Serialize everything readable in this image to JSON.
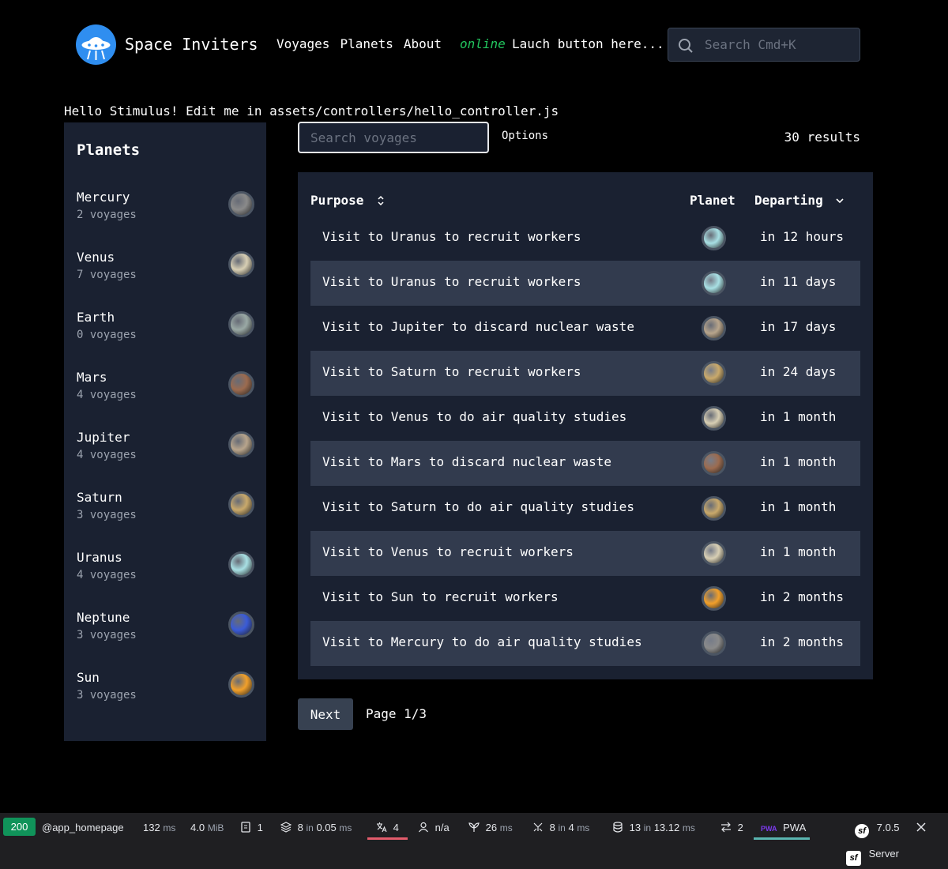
{
  "header": {
    "brand": "Space Inviters",
    "nav": [
      "Voyages",
      "Planets",
      "About"
    ],
    "online_status": "online",
    "launch_text": "Lauch button here...",
    "search_placeholder": "Search Cmd+K"
  },
  "hello_text": "Hello Stimulus! Edit me in assets/controllers/hello_controller.js",
  "sidebar": {
    "title": "Planets",
    "planets": [
      {
        "name": "Mercury",
        "count": "2 voyages",
        "color": "#8a8a8a"
      },
      {
        "name": "Venus",
        "count": "7 voyages",
        "color": "#d8cfb4"
      },
      {
        "name": "Earth",
        "count": "0 voyages",
        "color": "#9aa9a5"
      },
      {
        "name": "Mars",
        "count": "4 voyages",
        "color": "#9c6b4f"
      },
      {
        "name": "Jupiter",
        "count": "4 voyages",
        "color": "#b8a58c"
      },
      {
        "name": "Saturn",
        "count": "3 voyages",
        "color": "#c9a96b"
      },
      {
        "name": "Uranus",
        "count": "4 voyages",
        "color": "#a8e0e4"
      },
      {
        "name": "Neptune",
        "count": "3 voyages",
        "color": "#3a5bd8"
      },
      {
        "name": "Sun",
        "count": "3 voyages",
        "color": "#f2a02a"
      }
    ]
  },
  "voyages": {
    "search_placeholder": "Search voyages",
    "options_label": "Options",
    "results": "30 results",
    "columns": {
      "purpose": "Purpose",
      "planet": "Planet",
      "departing": "Departing"
    },
    "rows": [
      {
        "purpose": "Visit to Uranus to recruit workers",
        "planet": "Uranus",
        "color": "#a8e0e4",
        "departing": "in 12 hours"
      },
      {
        "purpose": "Visit to Uranus to recruit workers",
        "planet": "Uranus",
        "color": "#a8e0e4",
        "departing": "in 11 days"
      },
      {
        "purpose": "Visit to Jupiter to discard nuclear waste",
        "planet": "Jupiter",
        "color": "#b8a58c",
        "departing": "in 17 days"
      },
      {
        "purpose": "Visit to Saturn to recruit workers",
        "planet": "Saturn",
        "color": "#c9a96b",
        "departing": "in 24 days"
      },
      {
        "purpose": "Visit to Venus to do air quality studies",
        "planet": "Venus",
        "color": "#d8cfb4",
        "departing": "in 1 month"
      },
      {
        "purpose": "Visit to Mars to discard nuclear waste",
        "planet": "Mars",
        "color": "#9c6b4f",
        "departing": "in 1 month"
      },
      {
        "purpose": "Visit to Saturn to do air quality studies",
        "planet": "Saturn",
        "color": "#c9a96b",
        "departing": "in 1 month"
      },
      {
        "purpose": "Visit to Venus to recruit workers",
        "planet": "Venus",
        "color": "#d8cfb4",
        "departing": "in 1 month"
      },
      {
        "purpose": "Visit to Sun to recruit workers",
        "planet": "Sun",
        "color": "#f2a02a",
        "departing": "in 2 months"
      },
      {
        "purpose": "Visit to Mercury to do air quality studies",
        "planet": "Mercury",
        "color": "#8a8a8a",
        "departing": "in 2 months"
      }
    ],
    "next_label": "Next",
    "page_info": "Page 1/3"
  },
  "toolbar": {
    "status_code": "200",
    "route": "@app_homepage",
    "time_value": "132",
    "time_unit": "ms",
    "memory_value": "4.0",
    "memory_unit": "MiB",
    "forms": "1",
    "cache_value": "8",
    "cache_in": "in",
    "cache_time": "0.05",
    "cache_unit": "ms",
    "translations": "4",
    "user": "n/a",
    "twig_value": "26",
    "twig_unit": "ms",
    "events_value": "8",
    "events_in": "in",
    "events_time": "4",
    "events_unit": "ms",
    "db_value": "13",
    "db_in": "in",
    "db_time": "13.12",
    "db_unit": "ms",
    "http_calls": "2",
    "pwa_label": "PWA",
    "symfony_version": "7.0.5",
    "server_label": "Server",
    "colors": {
      "status": "#10935a",
      "red_underline": "#e35c6c",
      "teal_underline": "#5ab5b0"
    }
  }
}
